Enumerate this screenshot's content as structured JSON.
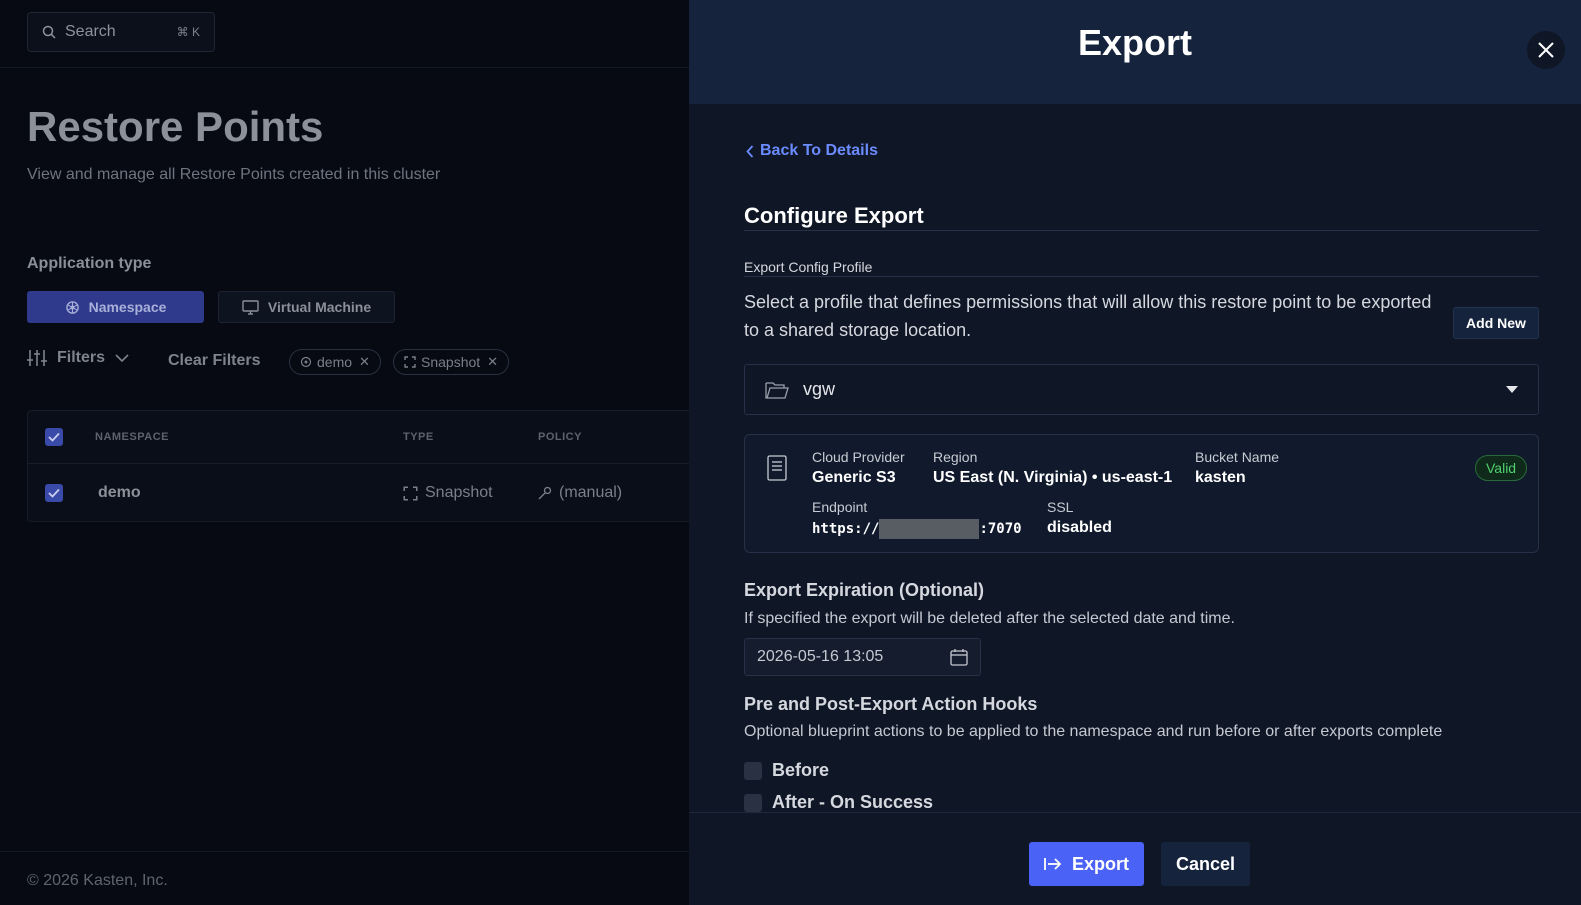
{
  "left": {
    "search": {
      "placeholder": "Search",
      "shortcut": "⌘ K"
    },
    "title": "Restore Points",
    "subtitle": "View and manage all Restore Points created in this cluster",
    "app_type": {
      "label": "Application type",
      "options": [
        "Namespace",
        "Virtual Machine"
      ],
      "selected": "Namespace"
    },
    "filters": {
      "label": "Filters",
      "clear": "Clear Filters",
      "chips": [
        "demo",
        "Snapshot"
      ]
    },
    "table": {
      "columns": [
        "NAMESPACE",
        "TYPE",
        "POLICY"
      ],
      "rows": [
        {
          "namespace": "demo",
          "type": "Snapshot",
          "policy": "(manual)"
        }
      ]
    },
    "footer": "© 2026 Kasten, Inc."
  },
  "drawer": {
    "title": "Export",
    "back": "Back To Details",
    "section_title": "Configure Export",
    "profile_label": "Export Config Profile",
    "profile_desc": "Select a profile that defines permissions that will allow this restore point to be exported to a shared storage location.",
    "add_new": "Add New",
    "selected_profile": "vgw",
    "profile": {
      "cloud_provider_label": "Cloud Provider",
      "cloud_provider": "Generic S3",
      "region_label": "Region",
      "region": "US East (N. Virginia) • us-east-1",
      "bucket_label": "Bucket Name",
      "bucket": "kasten",
      "endpoint_label": "Endpoint",
      "endpoint_prefix": "https://",
      "endpoint_suffix": ":7070",
      "ssl_label": "SSL",
      "ssl": "disabled",
      "status": "Valid"
    },
    "expiration": {
      "title": "Export Expiration (Optional)",
      "desc": "If specified the export will be deleted after the selected date and time.",
      "value": "2026-05-16 13:05"
    },
    "hooks": {
      "title": "Pre and Post-Export Action Hooks",
      "desc": "Optional blueprint actions to be applied to the namespace and run before or after exports complete",
      "options": [
        "Before",
        "After - On Success"
      ]
    },
    "buttons": {
      "export": "Export",
      "cancel": "Cancel"
    }
  },
  "colors": {
    "accent": "#4a62f5",
    "link": "#6b8bff",
    "valid": "#4fd06e",
    "drawer_header": "#15233c"
  }
}
